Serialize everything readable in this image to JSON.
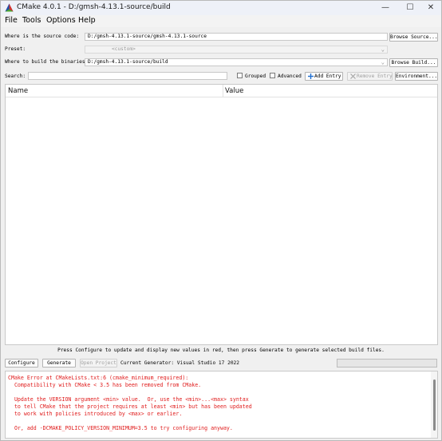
{
  "window": {
    "title": "CMake 4.0.1 - D:/gmsh-4.13.1-source/build",
    "controls": {
      "minimize": "—",
      "maximize": "☐",
      "close": "✕"
    }
  },
  "menu": [
    "File",
    "Tools",
    "Options",
    "Help"
  ],
  "form": {
    "source_label": "Where is the source code:",
    "source_value": "D:/gmsh-4.13.1-source/gmsh-4.13.1-source",
    "browse_source": "Browse Source...",
    "preset_label": "Preset:",
    "preset_value": "<custom>",
    "build_label": "Where to build the binaries:",
    "build_value": "D:/gmsh-4.13.1-source/build",
    "browse_build": "Browse Build...",
    "search_label": "Search:",
    "search_value": "",
    "grouped_label": "Grouped",
    "advanced_label": "Advanced",
    "add_entry": "Add Entry",
    "remove_entry": "Remove Entry",
    "environment": "Environment..."
  },
  "table": {
    "columns": [
      "Name",
      "Value"
    ],
    "rows": []
  },
  "hint": "Press Configure to update and display new values in red, then press Generate to generate selected build files.",
  "bottom": {
    "configure": "Configure",
    "generate": "Generate",
    "open_project": "Open Project",
    "generator_text": "Current Generator: Visual Studio 17 2022",
    "progress": 0
  },
  "output": [
    "CMake Error at CMakeLists.txt:6 (cmake_minimum_required):",
    "  Compatibility with CMake < 3.5 has been removed from CMake.",
    "",
    "  Update the VERSION argument <min> value.  Or, use the <min>...<max> syntax",
    "  to tell CMake that the project requires at least <min> but has been updated",
    "  to work with policies introduced by <max> or earlier.",
    "",
    "  Or, add -DCMAKE_POLICY_VERSION_MINIMUM=3.5 to try configuring anyway."
  ],
  "colors": {
    "error_text": "#e01b1b",
    "add_icon": "#1f6fd1"
  }
}
